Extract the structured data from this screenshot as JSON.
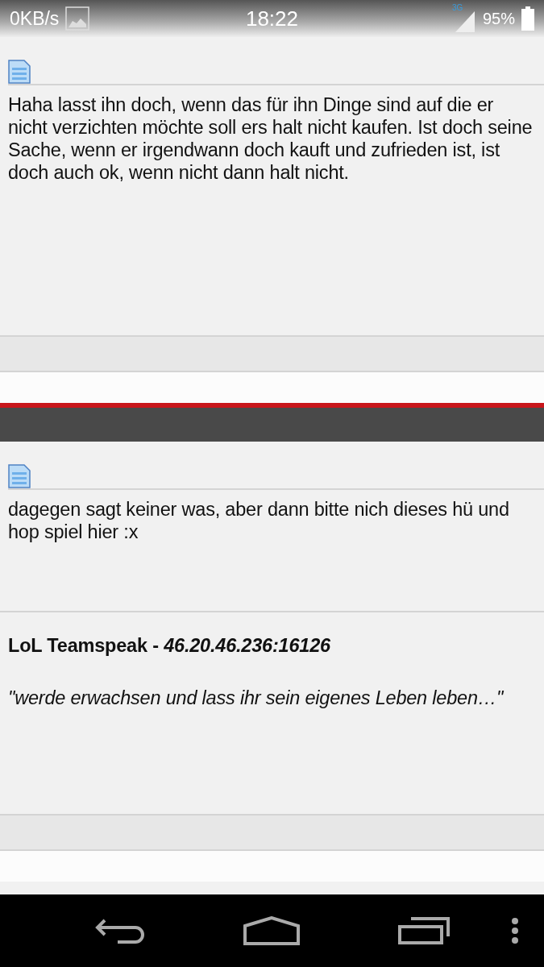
{
  "status_bar": {
    "speed": "0KB/s",
    "time": "18:22",
    "network": "3G",
    "battery": "95%"
  },
  "posts": [
    {
      "kind": "post",
      "text": "Haha lasst ihn doch, wenn das für ihn Dinge sind auf die er nicht verzichten möchte soll ers halt nicht kaufen. Ist doch seine Sache, wenn er irgendwann doch kauft und zufrieden ist, ist doch auch ok, wenn nicht dann halt nicht."
    },
    {
      "kind": "divider"
    },
    {
      "kind": "post",
      "text": "dagegen sagt keiner was, aber dann bitte nich dieses hü und hop spiel hier :x",
      "signature": {
        "title": "LoL Teamspeak - *46.20.46.236:16126*",
        "quote": "\"werde erwachsen und lass ihr sein eigenes Leben leben…\""
      }
    }
  ]
}
